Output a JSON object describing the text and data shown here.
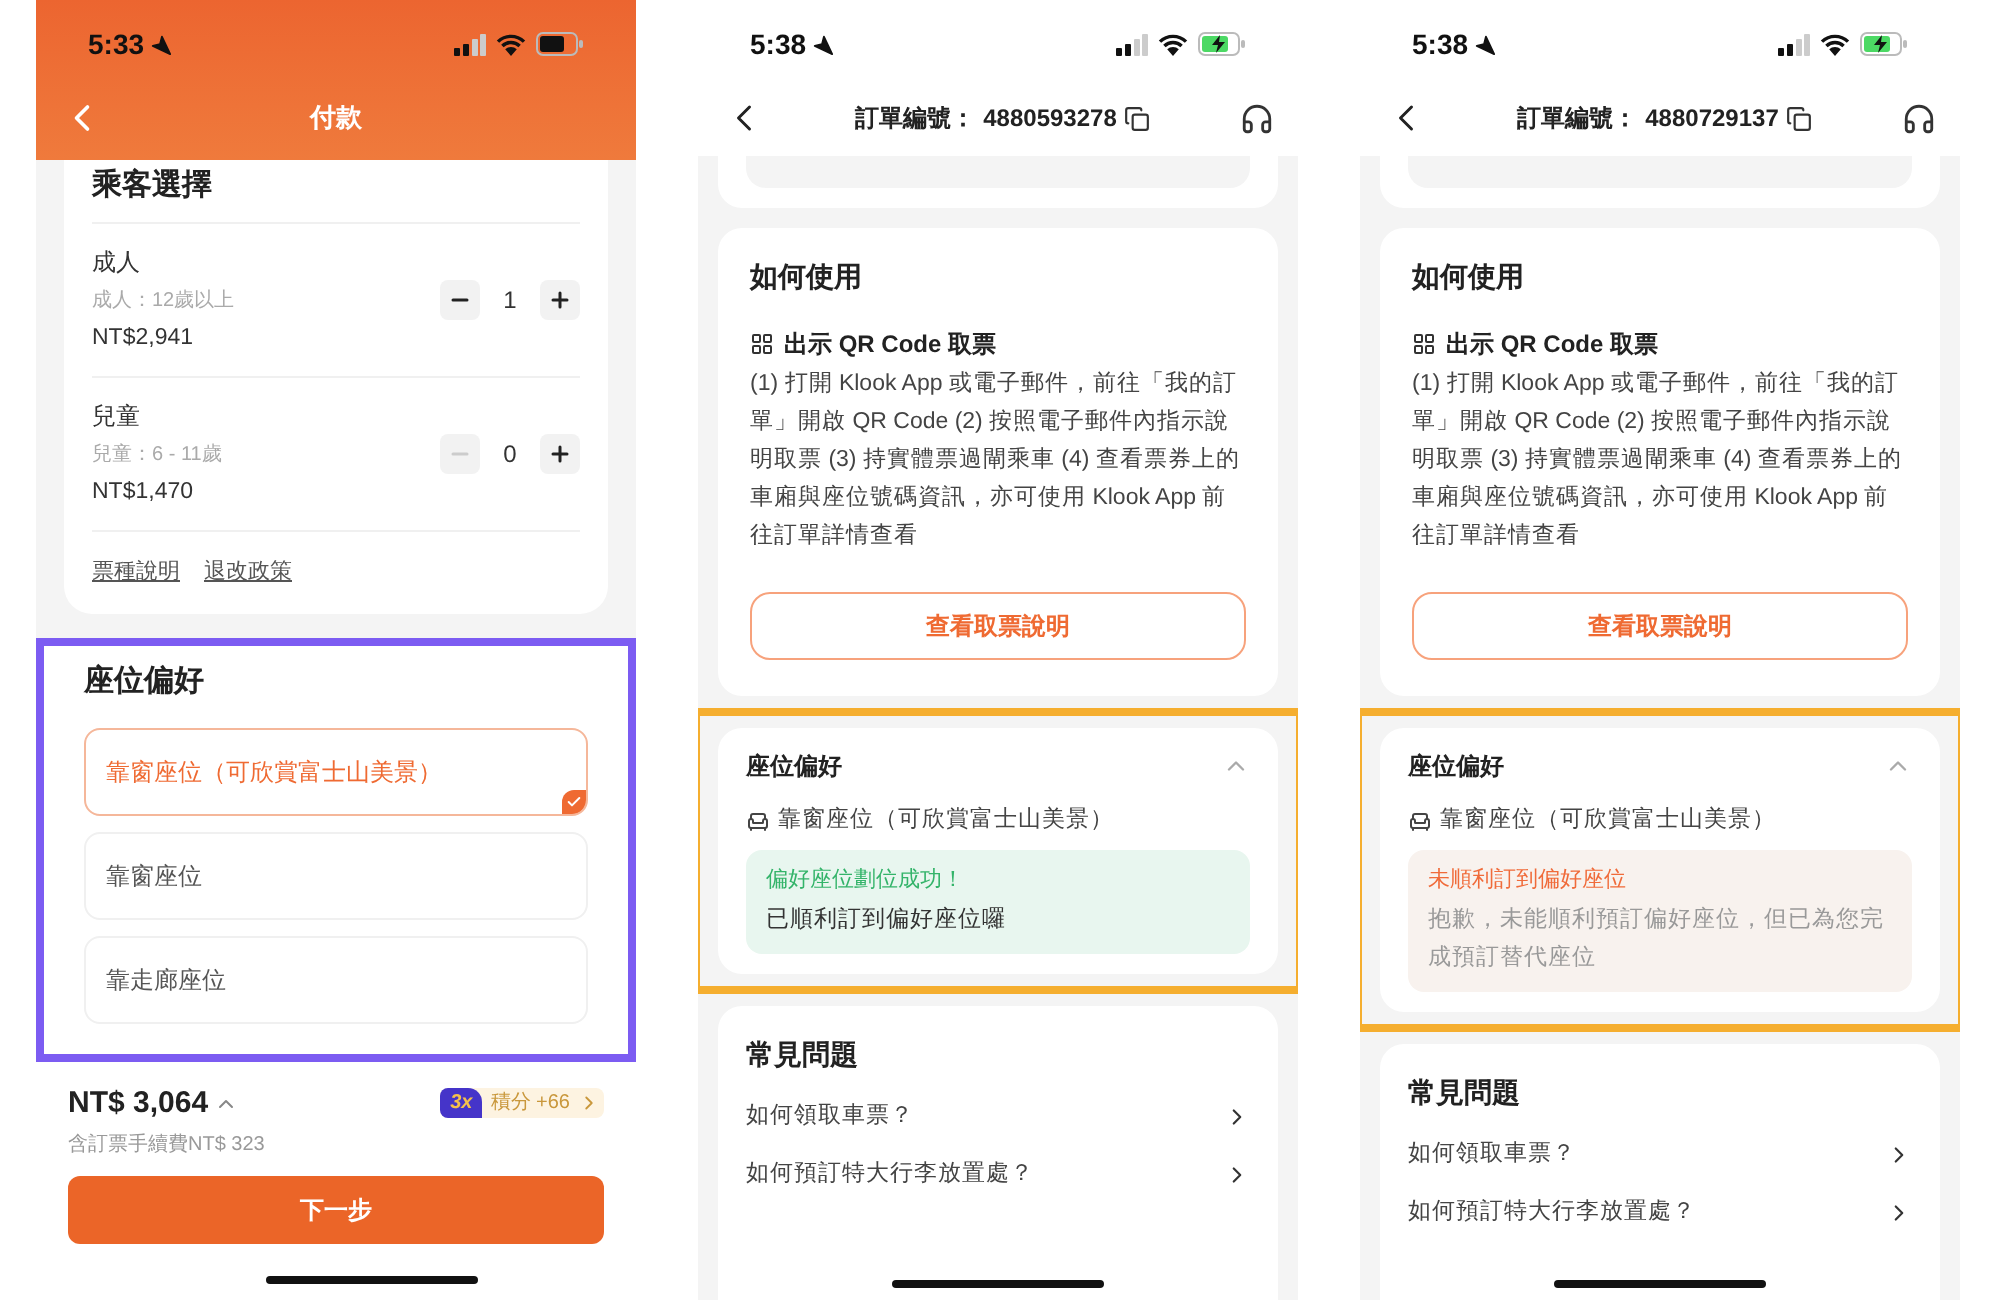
{
  "screens": [
    {
      "kind": "payment",
      "status_bar": {
        "time": "5:33",
        "charging": false
      },
      "title": "付款",
      "passengers": {
        "title": "乘客選擇",
        "rows": [
          {
            "name": "成人",
            "note": "成人：12歲以上",
            "price": "NT$2,941",
            "count": "1",
            "minus_disabled": false
          },
          {
            "name": "兒童",
            "note": "兒童：6 - 11歲",
            "price": "NT$1,470",
            "count": "0",
            "minus_disabled": true
          }
        ],
        "links": [
          "票種說明",
          "退改政策"
        ]
      },
      "seat_preference": {
        "title": "座位偏好",
        "options": [
          {
            "label": "靠窗座位（可欣賞富士山美景）",
            "selected": true
          },
          {
            "label": "靠窗座位",
            "selected": false
          },
          {
            "label": "靠走廊座位",
            "selected": false
          }
        ]
      },
      "footer": {
        "total": "NT$ 3,064",
        "fee": "含訂票手續費NT$ 323",
        "multiplier": "3x",
        "points": "積分 +66",
        "next_button": "下一步"
      }
    },
    {
      "kind": "order",
      "status_bar": {
        "time": "5:38",
        "charging": true
      },
      "order_label": "訂單編號：",
      "order_number": "4880593278",
      "how_to_use": {
        "title": "如何使用",
        "method": "出示 QR Code 取票",
        "instructions": "(1) 打開 Klook App 或電子郵件，前往「我的訂單」開啟 QR Code (2) 按照電子郵件內指示說明取票 (3) 持實體票過閘乘車 (4) 查看票券上的車廂與座位號碼資訊，亦可使用 Klook App 前往訂單詳情查看",
        "button": "查看取票說明"
      },
      "seat_preference": {
        "title": "座位偏好",
        "expanded": true,
        "seat": "靠窗座位（可欣賞富士山美景）",
        "result": {
          "kind": "success",
          "title": "偏好座位劃位成功！",
          "message": "已順利訂到偏好座位囉"
        }
      },
      "faq": {
        "title": "常見問題",
        "items": [
          "如何領取車票？",
          "如何預訂特大行李放置處？"
        ]
      }
    },
    {
      "kind": "order",
      "status_bar": {
        "time": "5:38",
        "charging": true
      },
      "order_label": "訂單編號：",
      "order_number": "4880729137",
      "how_to_use": {
        "title": "如何使用",
        "method": "出示 QR Code 取票",
        "instructions": "(1) 打開 Klook App 或電子郵件，前往「我的訂單」開啟 QR Code (2) 按照電子郵件內指示說明取票 (3) 持實體票過閘乘車 (4) 查看票券上的車廂與座位號碼資訊，亦可使用 Klook App 前往訂單詳情查看",
        "button": "查看取票說明"
      },
      "seat_preference": {
        "title": "座位偏好",
        "expanded": true,
        "seat": "靠窗座位（可欣賞富士山美景）",
        "result": {
          "kind": "failure",
          "title": "未順利訂到偏好座位",
          "message": "抱歉，未能順利預訂偏好座位，但已為您完成預訂替代座位"
        }
      },
      "faq": {
        "title": "常見問題",
        "items": [
          "如何領取車票？",
          "如何預訂特大行李放置處？"
        ]
      }
    }
  ]
}
